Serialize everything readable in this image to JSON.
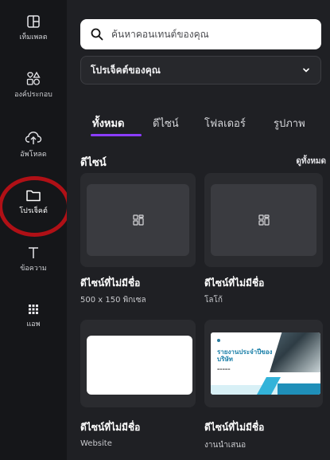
{
  "rail": {
    "items": [
      {
        "label": "เท็มเพลต",
        "icon": "template-icon"
      },
      {
        "label": "องค์ประกอบ",
        "icon": "elements-icon"
      },
      {
        "label": "อัพโหลด",
        "icon": "cloud-upload-icon"
      },
      {
        "label": "โปรเจ็คต์",
        "icon": "folder-icon"
      },
      {
        "label": "ข้อความ",
        "icon": "text-icon"
      },
      {
        "label": "แอพ",
        "icon": "apps-grid-icon"
      }
    ],
    "active_index": 3,
    "highlight_color": "#b01016"
  },
  "search": {
    "placeholder": "ค้นหาคอนเทนต์ของคุณ",
    "value": ""
  },
  "scope_select": {
    "selected": "โปรเจ็คต์ของคุณ"
  },
  "tabs": [
    {
      "label": "ทั้งหมด",
      "active": true
    },
    {
      "label": "ดีไซน์",
      "active": false
    },
    {
      "label": "โฟลเดอร์",
      "active": false
    },
    {
      "label": "รูปภาพ",
      "active": false
    }
  ],
  "accent_color": "#8b3dff",
  "section": {
    "title": "ดีไซน์",
    "see_all": "ดูทั้งหมด"
  },
  "cards": [
    {
      "title": "ดีไซน์ที่ไม่มีชื่อ",
      "subtitle": "500 x 150 พิกเซล",
      "thumb": "placeholder"
    },
    {
      "title": "ดีไซน์ที่ไม่มีชื่อ",
      "subtitle": "โลโก้",
      "thumb": "placeholder"
    },
    {
      "title": "ดีไซน์ที่ไม่มีชื่อ",
      "subtitle": "Website",
      "thumb": "blank-white"
    },
    {
      "title": "ดีไซน์ที่ไม่มีชื่อ",
      "subtitle": "งานนำเสนอ",
      "thumb": "presentation"
    }
  ],
  "presentation_thumb": {
    "title": "รายงานประจำปีของบริษัท"
  }
}
